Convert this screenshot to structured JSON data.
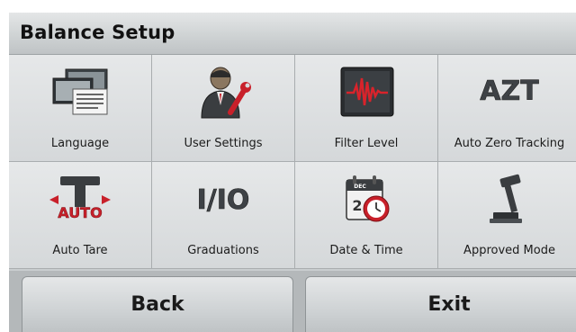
{
  "header": {
    "title": "Balance Setup"
  },
  "menu": {
    "items": [
      {
        "label": "Language",
        "icon": "language-icon"
      },
      {
        "label": "User Settings",
        "icon": "user-settings-icon"
      },
      {
        "label": "Filter Level",
        "icon": "filter-level-icon"
      },
      {
        "label": "Auto Zero Tracking",
        "icon": "azt-icon",
        "icon_text": "AZT"
      },
      {
        "label": "Auto Tare",
        "icon": "auto-tare-icon",
        "icon_text": "AUTO"
      },
      {
        "label": "Graduations",
        "icon": "io-icon",
        "icon_text": "I/IO"
      },
      {
        "label": "Date & Time",
        "icon": "calendar-clock-icon",
        "icon_text": "DEC"
      },
      {
        "label": "Approved Mode",
        "icon": "gavel-icon"
      }
    ]
  },
  "footer": {
    "back_label": "Back",
    "exit_label": "Exit"
  },
  "colors": {
    "accent_red": "#c8202a",
    "background": "#c9cdcf"
  }
}
